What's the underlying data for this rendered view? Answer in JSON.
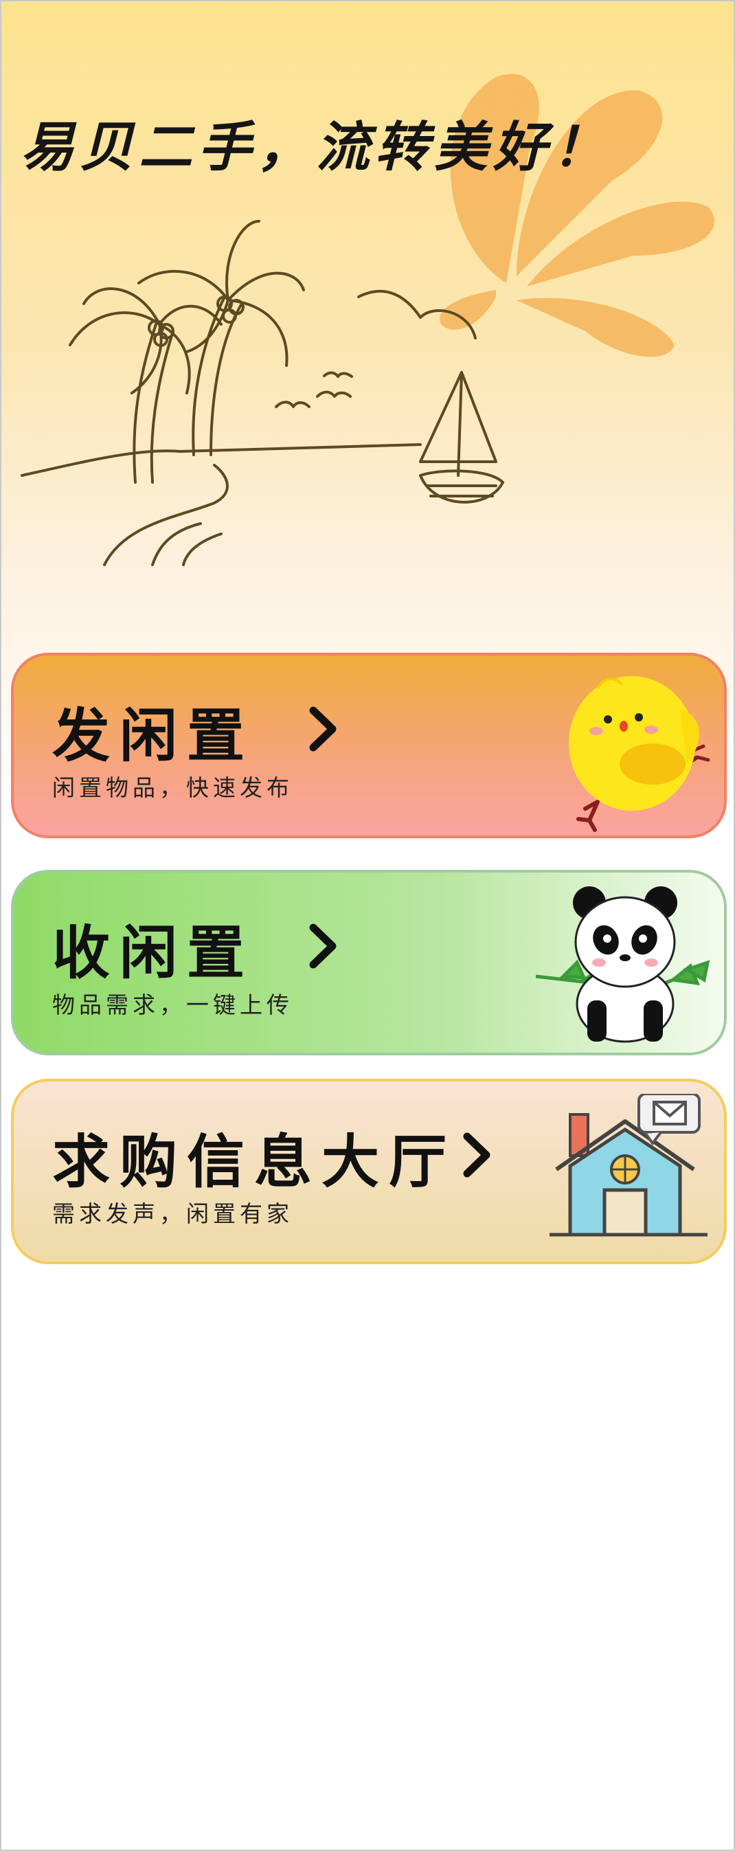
{
  "hero": {
    "slogan": "易贝二手，流转美好！",
    "sun_icon": "sun-rays-icon",
    "sketch_icon": "beach-sketch-illustration"
  },
  "cards": [
    {
      "title": "发闲置",
      "subtitle": "闲置物品，快速发布",
      "icon": "chick-icon",
      "arrow": "chevron-right-icon",
      "accent": "#f0ac3c"
    },
    {
      "title": "收闲置",
      "subtitle": "物品需求，一键上传",
      "icon": "panda-icon",
      "arrow": "chevron-right-icon",
      "accent": "#8fdb66"
    },
    {
      "title": "求购信息大厅",
      "subtitle": "需求发声，闲置有家",
      "icon": "house-mail-icon",
      "arrow": "chevron-right-icon",
      "accent": "#f2cd5e"
    }
  ]
}
